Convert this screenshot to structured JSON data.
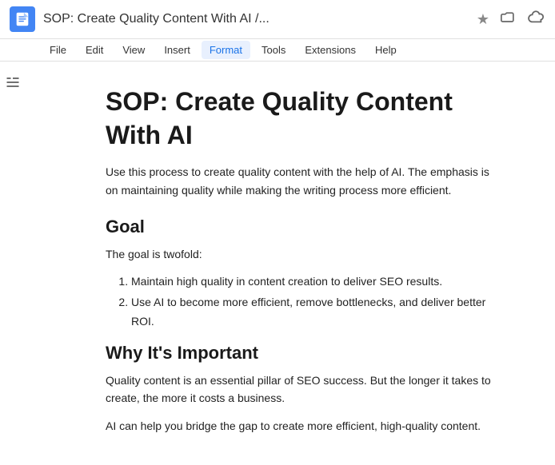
{
  "titleBar": {
    "title": "SOP: Create Quality Content With AI /...",
    "appIconLabel": "Google Docs",
    "starLabel": "★",
    "folderLabel": "📁",
    "cloudLabel": "☁"
  },
  "menuBar": {
    "items": [
      "File",
      "Edit",
      "View",
      "Insert",
      "Format",
      "Tools",
      "Extensions",
      "Help"
    ],
    "activeItem": "Format"
  },
  "toolbar": {
    "outlineIconLabel": "≡"
  },
  "document": {
    "title": "SOP: Create Quality Content With AI",
    "intro": "Use this process to create quality content with the help of AI. The emphasis is on maintaining quality while making the writing process more efficient.",
    "sections": [
      {
        "heading": "Goal",
        "paragraphs": [
          "The goal is twofold:"
        ],
        "list": [
          "Maintain high quality in content creation to deliver SEO results.",
          "Use AI to become more efficient, remove bottlenecks, and deliver better ROI."
        ],
        "listType": "ordered"
      },
      {
        "heading": "Why It's Important",
        "paragraphs": [
          "Quality content is an essential pillar of SEO success. But the longer it takes to create, the more it costs a business.",
          "AI can help you bridge the gap to create more efficient, high-quality content."
        ],
        "list": [],
        "listType": "none"
      }
    ]
  }
}
